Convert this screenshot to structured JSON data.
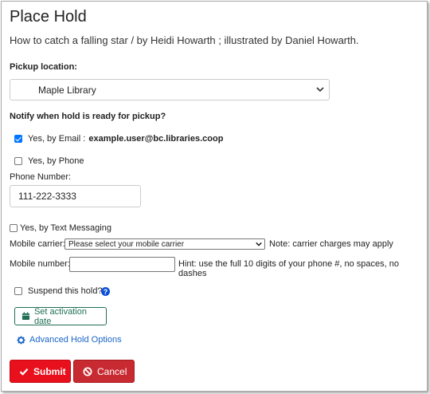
{
  "header": {
    "title": "Place Hold",
    "subtitle": "How to catch a falling star / by Heidi Howarth ; illustrated by Daniel Howarth."
  },
  "pickup": {
    "label": "Pickup location:",
    "selected": "Maple Library"
  },
  "notify": {
    "label": "Notify when hold is ready for pickup?",
    "email": {
      "label": "Yes, by Email :",
      "address": "example.user@bc.libraries.coop",
      "checked": true
    },
    "phone": {
      "label": "Yes, by Phone",
      "checked": false
    },
    "phone_number_label": "Phone Number:",
    "phone_number_value": "111-222-3333",
    "text": {
      "label": "Yes, by Text Messaging",
      "checked": false
    },
    "carrier_label": "Mobile carrier:",
    "carrier_selected": "Please select your mobile carrier",
    "carrier_note": "Note: carrier charges may apply",
    "mobile_label": "Mobile number:",
    "mobile_value": "",
    "mobile_hint": "Hint: use the full 10 digits of your phone #, no spaces, no dashes"
  },
  "suspend": {
    "label": "Suspend this hold?",
    "checked": false,
    "help_glyph": "?",
    "activation_button": "Set activation date"
  },
  "advanced": {
    "label": "Advanced Hold Options"
  },
  "actions": {
    "submit": "Submit",
    "cancel": "Cancel"
  },
  "colors": {
    "submit": "#e8101c",
    "cancel": "#c82a31",
    "link": "#1a66c6",
    "activation": "#1f6f55",
    "check": "#0075ff"
  },
  "icons": {
    "pickup_dropdown": "chevron-down-icon",
    "carrier_dropdown": "chevron-down-icon",
    "help": "question-circle-icon",
    "activation": "calendar-icon",
    "advanced": "gear-icon",
    "submit": "check-icon",
    "cancel": "ban-icon"
  }
}
